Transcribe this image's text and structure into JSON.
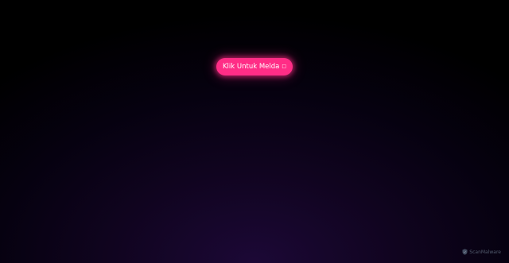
{
  "button": {
    "label": "Klik Untuk Melda",
    "icon": "notification-square-icon",
    "color": "#ff2d86"
  },
  "watermark": {
    "label": "ScanMalware",
    "icon": "shield-logo-icon"
  },
  "background": {
    "top_color": "#000000",
    "glow_color": "#1c0836"
  }
}
